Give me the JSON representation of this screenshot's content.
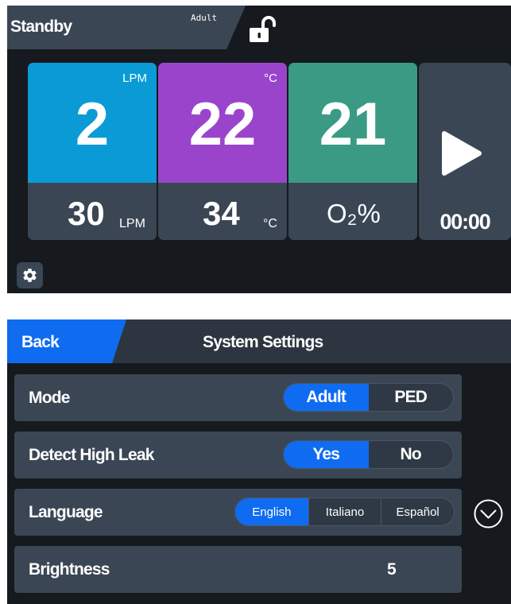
{
  "standby": {
    "status": "Standby",
    "mode": "Adult",
    "flow": {
      "value": "2",
      "unit": "LPM",
      "target": "30",
      "target_unit": "LPM"
    },
    "temperature": {
      "value": "22",
      "unit": "°C",
      "target": "34",
      "target_unit": "°C"
    },
    "oxygen": {
      "value": "21",
      "label": "O₂%"
    },
    "timer": "00:00",
    "icons": {
      "lock": "unlocked-padlock-icon",
      "start": "play-icon",
      "settings": "gear-icon"
    },
    "colors": {
      "flow": "#0a9bd6",
      "temperature": "#9a44cc",
      "oxygen": "#3b9a84",
      "accent": "#0f6cf1"
    }
  },
  "settings": {
    "back_label": "Back",
    "title": "System Settings",
    "mode": {
      "label": "Mode",
      "options": [
        "Adult",
        "PED"
      ],
      "selected": "Adult"
    },
    "detect_high_leak": {
      "label": "Detect High Leak",
      "options": [
        "Yes",
        "No"
      ],
      "selected": "Yes"
    },
    "language": {
      "label": "Language",
      "options": [
        "English",
        "Italiano",
        "Español"
      ],
      "selected": "English"
    },
    "brightness": {
      "label": "Brightness",
      "value": "5"
    },
    "icons": {
      "scroll": "chevron-down-icon"
    }
  }
}
